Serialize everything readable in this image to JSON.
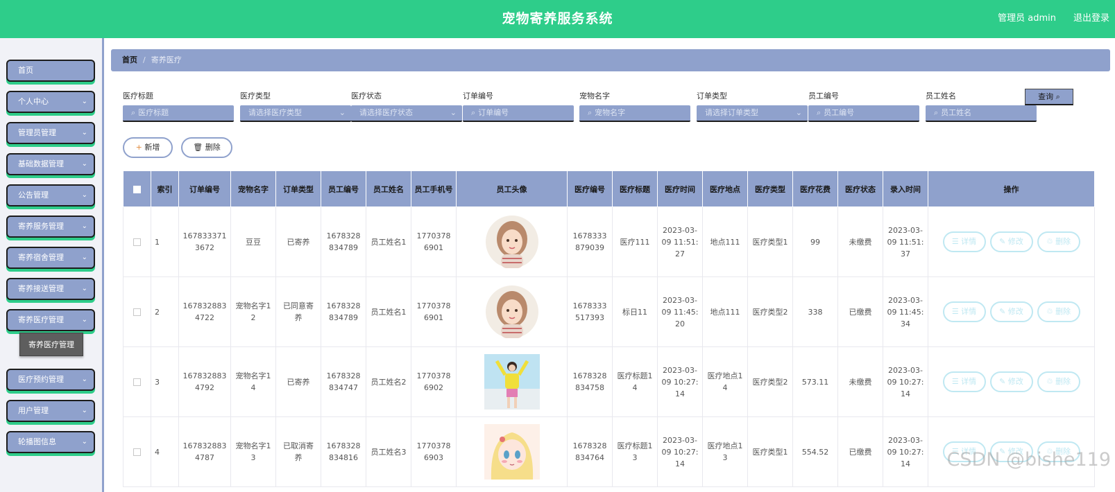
{
  "header": {
    "title": "宠物寄养服务系统",
    "user": "管理员 admin",
    "logout": "退出登录"
  },
  "sidebar": {
    "items": [
      {
        "label": "首页",
        "has_arrow": false
      },
      {
        "label": "个人中心",
        "has_arrow": true
      },
      {
        "label": "管理员管理",
        "has_arrow": true
      },
      {
        "label": "基础数据管理",
        "has_arrow": true
      },
      {
        "label": "公告管理",
        "has_arrow": true
      },
      {
        "label": "寄养服务管理",
        "has_arrow": true
      },
      {
        "label": "寄养宿舍管理",
        "has_arrow": true
      },
      {
        "label": "寄养接送管理",
        "has_arrow": true
      },
      {
        "label": "寄养医疗管理",
        "has_arrow": true
      },
      {
        "label": "医疗预约管理",
        "has_arrow": true
      },
      {
        "label": "用户管理",
        "has_arrow": true
      },
      {
        "label": "轮播图信息",
        "has_arrow": true
      }
    ],
    "submenu_label": "寄养医疗管理"
  },
  "breadcrumb": {
    "home": "首页",
    "separator": "/",
    "current": "寄养医疗"
  },
  "search": {
    "fields": [
      {
        "label": "医疗标题",
        "placeholder": "医疗标题",
        "type": "input"
      },
      {
        "label": "医疗类型",
        "placeholder": "请选择医疗类型",
        "type": "select"
      },
      {
        "label": "医疗状态",
        "placeholder": "请选择医疗状态",
        "type": "select"
      },
      {
        "label": "订单编号",
        "placeholder": "订单编号",
        "type": "input"
      },
      {
        "label": "宠物名字",
        "placeholder": "宠物名字",
        "type": "input"
      },
      {
        "label": "订单类型",
        "placeholder": "请选择订单类型",
        "type": "select"
      },
      {
        "label": "员工编号",
        "placeholder": "员工编号",
        "type": "input"
      },
      {
        "label": "员工姓名",
        "placeholder": "员工姓名",
        "type": "input"
      }
    ],
    "query_label": "查询"
  },
  "actions": {
    "add_label": "新增",
    "delete_label": "删除"
  },
  "table": {
    "columns": [
      "索引",
      "订单编号",
      "宠物名字",
      "订单类型",
      "员工编号",
      "员工姓名",
      "员工手机号",
      "员工头像",
      "医疗编号",
      "医疗标题",
      "医疗时间",
      "医疗地点",
      "医疗类型",
      "医疗花费",
      "医疗状态",
      "录入时间",
      "操作"
    ],
    "rows": [
      {
        "index": "1",
        "order_no": "1678333713672",
        "pet_name": "豆豆",
        "order_type": "已寄养",
        "staff_no": "1678328834789",
        "staff_name": "员工姓名1",
        "staff_phone": "17703786901",
        "avatar": "girl-hair-bun",
        "medical_no": "1678333879039",
        "medical_title": "医疗111",
        "medical_time": "2023-03-09 11:51:27",
        "medical_place": "地点111",
        "medical_type": "医疗类型1",
        "medical_cost": "99",
        "medical_status": "未缴费",
        "entry_time": "2023-03-09 11:51:37"
      },
      {
        "index": "2",
        "order_no": "1678328834722",
        "pet_name": "宠物名字12",
        "order_type": "已同意寄养",
        "staff_no": "1678328834789",
        "staff_name": "员工姓名1",
        "staff_phone": "17703786901",
        "avatar": "girl-hair-bun",
        "medical_no": "1678333517393",
        "medical_title": "标日11",
        "medical_time": "2023-03-09 11:45:20",
        "medical_place": "地点111",
        "medical_type": "医疗类型2",
        "medical_cost": "338",
        "medical_status": "已缴费",
        "entry_time": "2023-03-09 11:45:34"
      },
      {
        "index": "3",
        "order_no": "1678328834792",
        "pet_name": "宠物名字14",
        "order_type": "已寄养",
        "staff_no": "1678328834747",
        "staff_name": "员工姓名2",
        "staff_phone": "17703786902",
        "avatar": "girl-yellow-beach",
        "medical_no": "1678328834758",
        "medical_title": "医疗标题14",
        "medical_time": "2023-03-09 10:27:14",
        "medical_place": "医疗地点14",
        "medical_type": "医疗类型2",
        "medical_cost": "573.11",
        "medical_status": "未缴费",
        "entry_time": "2023-03-09 10:27:14"
      },
      {
        "index": "4",
        "order_no": "1678328834787",
        "pet_name": "宠物名字13",
        "order_type": "已取消寄养",
        "staff_no": "1678328834816",
        "staff_name": "员工姓名3",
        "staff_phone": "17703786903",
        "avatar": "anime-blonde",
        "medical_no": "1678328834764",
        "medical_title": "医疗标题13",
        "medical_time": "2023-03-09 10:27:14",
        "medical_place": "医疗地点13",
        "medical_type": "医疗类型1",
        "medical_cost": "554.52",
        "medical_status": "已缴费",
        "entry_time": "2023-03-09 10:27:14"
      }
    ],
    "row_ops": {
      "detail": "详情",
      "edit": "修改",
      "delete": "删除"
    }
  },
  "watermark": "CSDN @bishe119",
  "colors": {
    "header": "#2ecd8a",
    "panel": "#8fa1cc",
    "op_button": "#bfe8f2"
  }
}
